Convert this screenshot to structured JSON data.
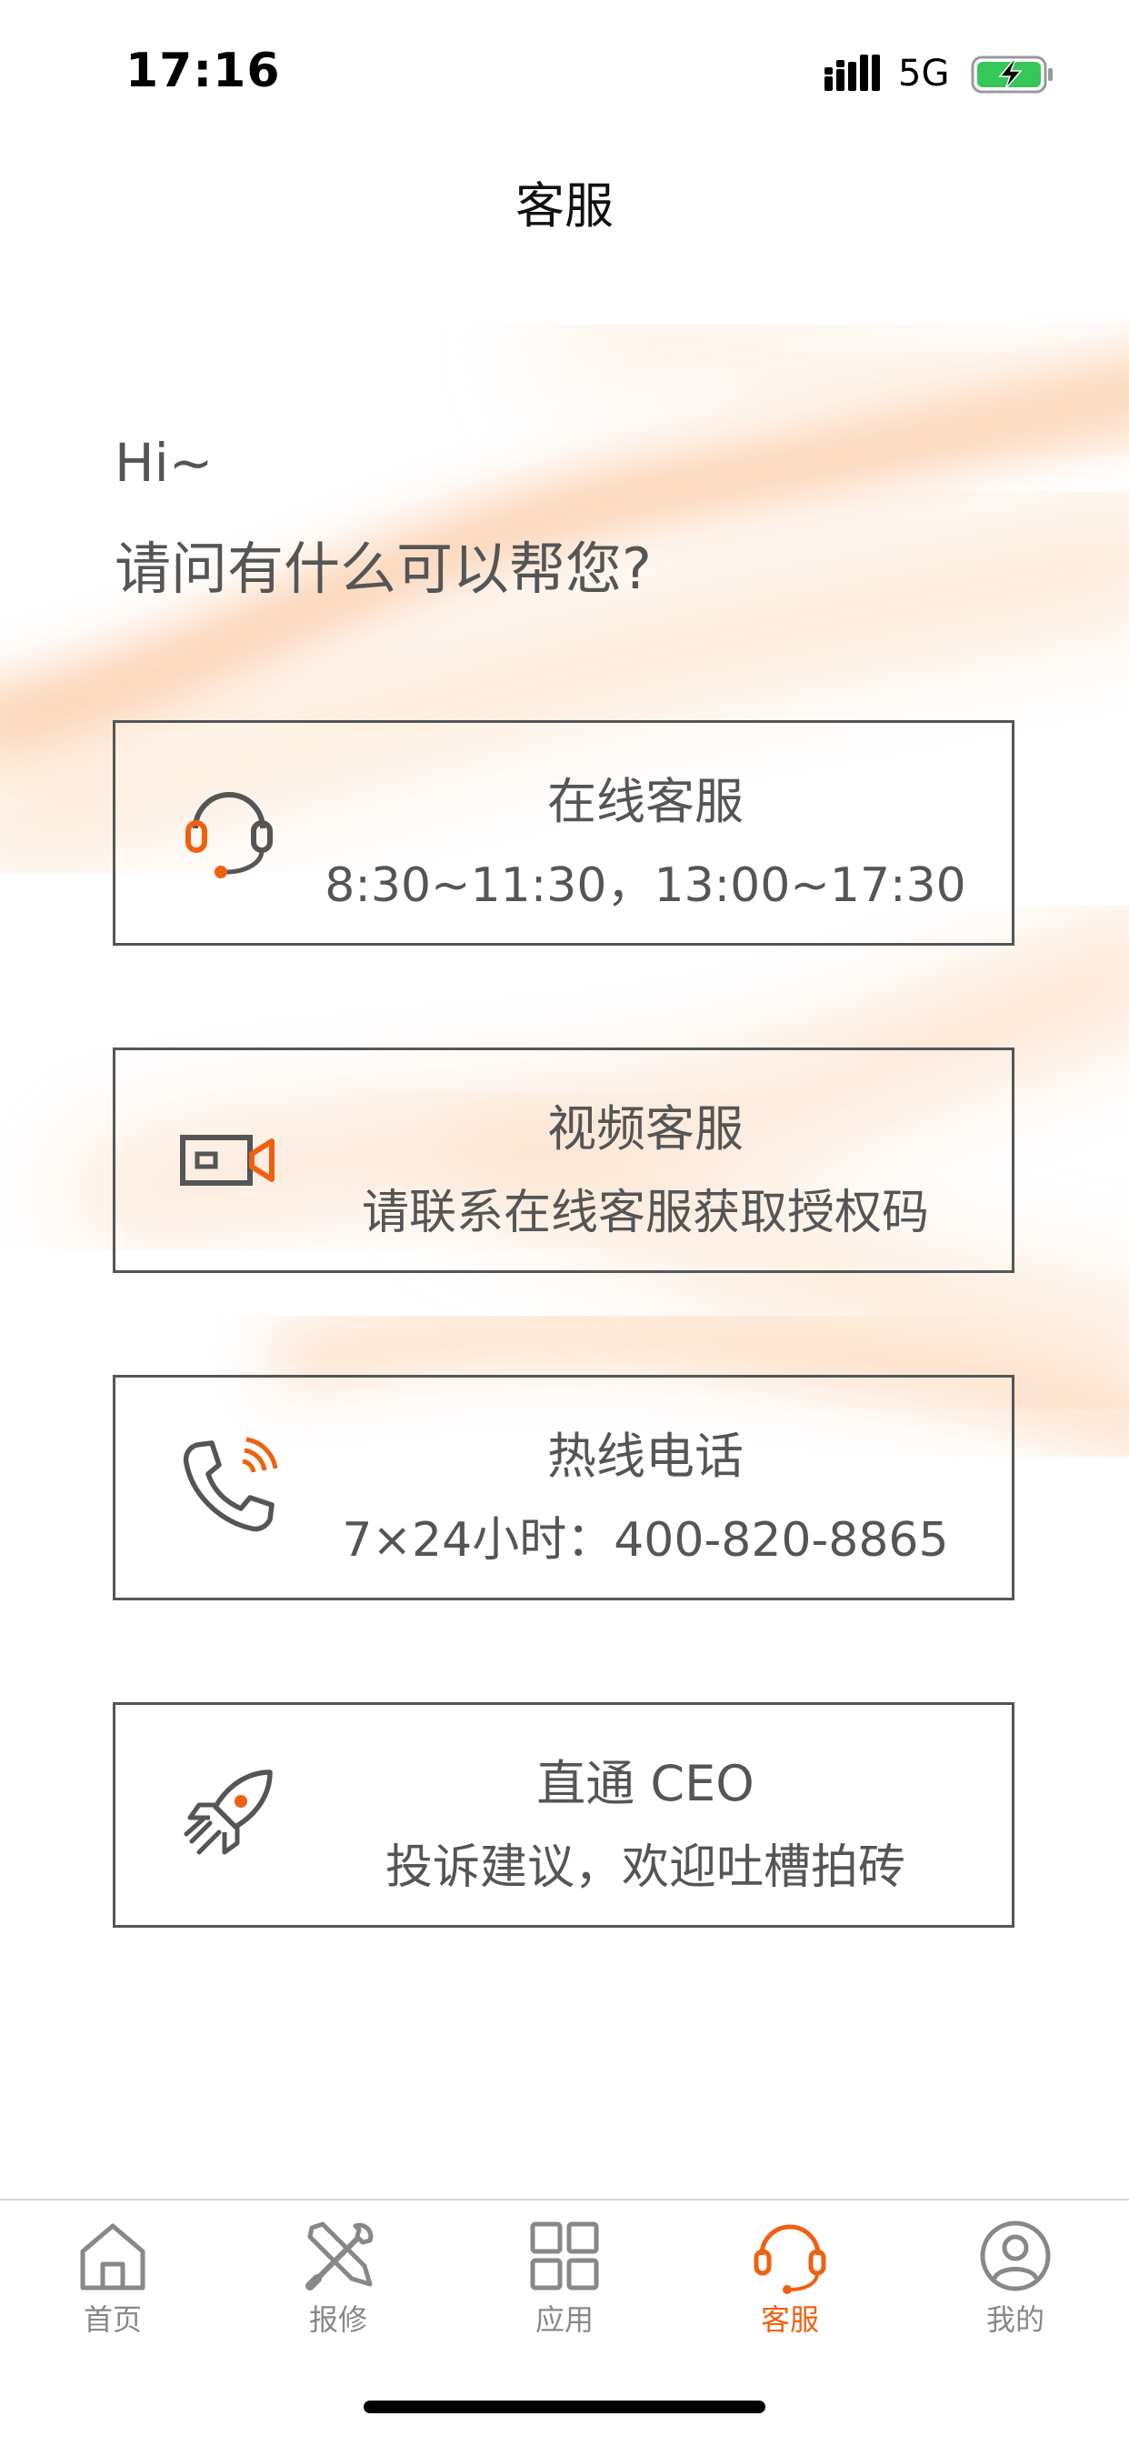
{
  "status_bar": {
    "time": "17:16",
    "network": "5G",
    "icons": [
      "signal-icon",
      "battery-charging-icon"
    ]
  },
  "header": {
    "title": "客服"
  },
  "greeting": {
    "hi": "Hi~",
    "question": "请问有什么可以帮您?"
  },
  "cards": [
    {
      "title": "在线客服",
      "subtitle": "8:30~11:30，13:00~17:30",
      "icon": "headset-icon"
    },
    {
      "title": "视频客服",
      "subtitle": "请联系在线客服获取授权码",
      "icon": "video-camera-icon"
    },
    {
      "title": "热线电话",
      "subtitle": "7×24小时：400-820-8865",
      "icon": "phone-icon"
    },
    {
      "title": "直通 CEO",
      "subtitle": "投诉建议，欢迎吐槽拍砖",
      "icon": "rocket-icon"
    }
  ],
  "tab_bar": {
    "tabs": [
      {
        "label": "首页",
        "icon": "home-icon"
      },
      {
        "label": "报修",
        "icon": "tools-icon"
      },
      {
        "label": "应用",
        "icon": "grid-icon"
      },
      {
        "label": "客服",
        "icon": "headset-icon"
      },
      {
        "label": "我的",
        "icon": "user-icon"
      }
    ],
    "active_index": 3
  },
  "colors": {
    "accent": "#f0600f",
    "text": "#555555",
    "border": "#555555",
    "inactive_tab": "#888888"
  }
}
